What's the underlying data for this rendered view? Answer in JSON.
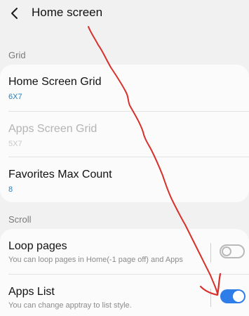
{
  "header": {
    "back_icon": "chevron-left-icon",
    "title": "Home screen"
  },
  "sections": {
    "grid_header": "Grid",
    "scroll_header": "Scroll"
  },
  "grid_items": [
    {
      "title": "Home Screen Grid",
      "value": "6X7",
      "disabled": false
    },
    {
      "title": "Apps Screen Grid",
      "value": "5X7",
      "disabled": true
    },
    {
      "title": "Favorites Max Count",
      "value": "8",
      "disabled": false
    }
  ],
  "scroll_items": [
    {
      "title": "Loop pages",
      "description": "You can loop pages in Home(-1 page off) and Apps",
      "toggle": "off"
    },
    {
      "title": "Apps List",
      "description": "You can change apptray to list style.",
      "toggle": "on"
    }
  ],
  "colors": {
    "background": "#f1f1f1",
    "card": "#fbfbfb",
    "value_blue": "#2a7fb6",
    "toggle_on": "#2e7de8",
    "annotation_red": "#d9302c"
  },
  "annotation": "hand-drawn red arrow pointing to the Apps List toggle"
}
